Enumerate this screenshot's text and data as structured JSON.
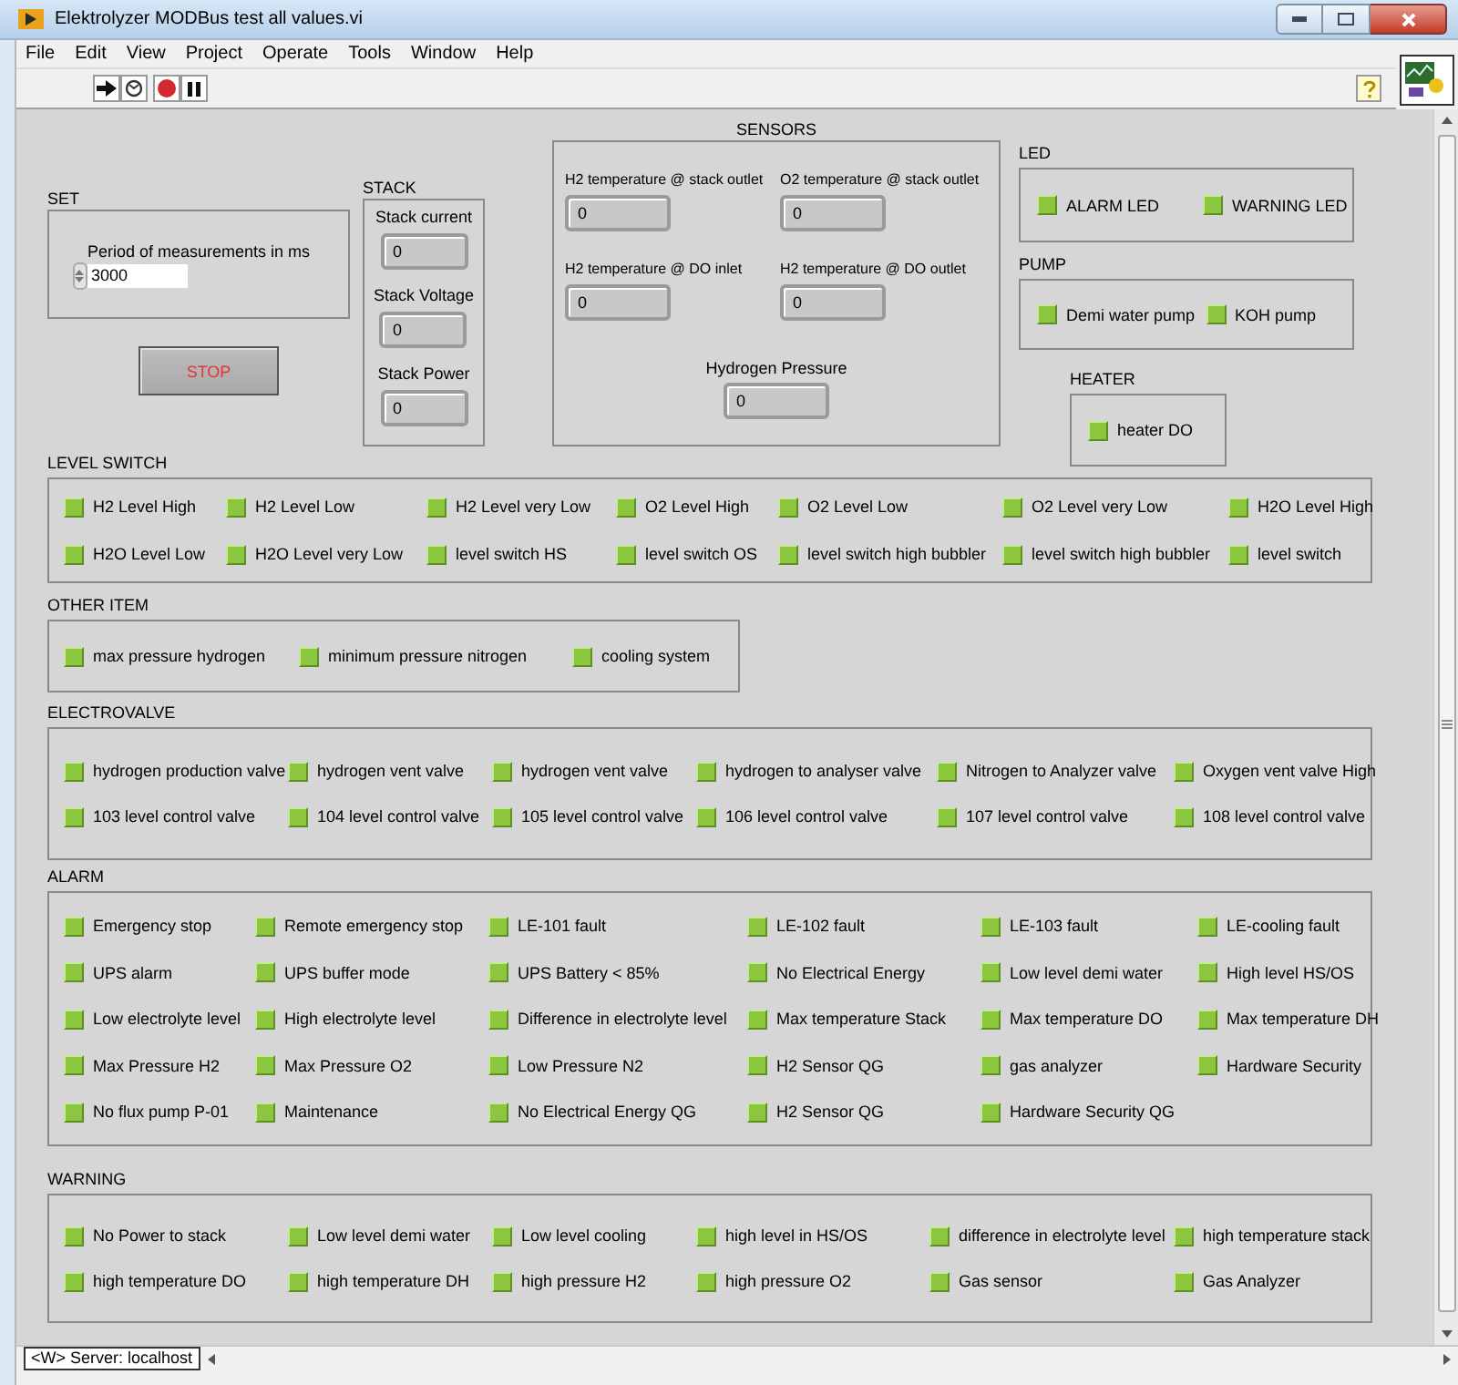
{
  "window": {
    "title": "Elektrolyzer MODBus test all values.vi"
  },
  "menu": [
    "File",
    "Edit",
    "View",
    "Project",
    "Operate",
    "Tools",
    "Window",
    "Help"
  ],
  "set": {
    "label": "SET",
    "control": {
      "label": "Period of measurements in ms",
      "value": "3000"
    }
  },
  "stop_button": "STOP",
  "stack": {
    "label": "STACK",
    "indicators": [
      {
        "label": "Stack current",
        "value": "0"
      },
      {
        "label": "Stack Voltage",
        "value": "0"
      },
      {
        "label": "Stack Power",
        "value": "0"
      }
    ]
  },
  "sensors": {
    "label": "SENSORS",
    "indicators": [
      {
        "label": "H2 temperature @ stack outlet",
        "value": "0"
      },
      {
        "label": "O2 temperature @ stack outlet",
        "value": "0"
      },
      {
        "label": "H2 temperature @ DO inlet",
        "value": "0"
      },
      {
        "label": "H2 temperature @ DO outlet",
        "value": "0"
      },
      {
        "label": "Hydrogen Pressure",
        "value": "0"
      }
    ]
  },
  "side_groups": [
    {
      "label": "LED",
      "leds": [
        {
          "label": "ALARM LED",
          "on": true
        },
        {
          "label": "WARNING LED",
          "on": true
        }
      ]
    },
    {
      "label": "PUMP",
      "leds": [
        {
          "label": "Demi water pump",
          "on": true
        },
        {
          "label": "KOH pump",
          "on": true
        }
      ]
    },
    {
      "label": "HEATER",
      "leds": [
        {
          "label": "heater DO",
          "on": true
        }
      ]
    }
  ],
  "sections": [
    {
      "label": "LEVEL SWITCH",
      "leds": [
        {
          "label": "H2 Level High",
          "on": true
        },
        {
          "label": "H2 Level Low",
          "on": true
        },
        {
          "label": "H2 Level very Low",
          "on": true
        },
        {
          "label": "O2 Level High",
          "on": true
        },
        {
          "label": "O2 Level Low",
          "on": true
        },
        {
          "label": "O2 Level very Low",
          "on": true
        },
        {
          "label": "H2O Level High",
          "on": true
        },
        {
          "label": "H2O Level Low",
          "on": true
        },
        {
          "label": "H2O Level very Low",
          "on": true
        },
        {
          "label": "level switch HS",
          "on": true
        },
        {
          "label": "level switch OS",
          "on": true
        },
        {
          "label": "level switch high bubbler",
          "on": true
        },
        {
          "label": "level switch high bubbler",
          "on": true
        },
        {
          "label": "level switch",
          "on": true
        }
      ]
    },
    {
      "label": "OTHER ITEM",
      "leds": [
        {
          "label": "max pressure hydrogen",
          "on": true
        },
        {
          "label": "minimum pressure nitrogen",
          "on": true
        },
        {
          "label": "cooling system",
          "on": true
        }
      ]
    },
    {
      "label": "ELECTROVALVE",
      "leds": [
        {
          "label": "hydrogen production valve",
          "on": true
        },
        {
          "label": "hydrogen vent valve",
          "on": true
        },
        {
          "label": "hydrogen vent valve",
          "on": true
        },
        {
          "label": "hydrogen to analyser valve",
          "on": true
        },
        {
          "label": "Nitrogen to Analyzer valve",
          "on": true
        },
        {
          "label": "Oxygen vent valve High",
          "on": true
        },
        {
          "label": "103 level control valve",
          "on": true
        },
        {
          "label": "104 level control valve",
          "on": true
        },
        {
          "label": "105 level control valve",
          "on": true
        },
        {
          "label": "106 level control valve",
          "on": true
        },
        {
          "label": "107 level control valve",
          "on": true
        },
        {
          "label": "108 level control valve",
          "on": true
        }
      ]
    },
    {
      "label": "ALARM",
      "leds": [
        {
          "label": "Emergency stop",
          "on": true
        },
        {
          "label": "Remote emergency stop",
          "on": true
        },
        {
          "label": "LE-101 fault",
          "on": true
        },
        {
          "label": "LE-102 fault",
          "on": true
        },
        {
          "label": "LE-103 fault",
          "on": true
        },
        {
          "label": "LE-cooling fault",
          "on": true
        },
        {
          "label": "UPS alarm",
          "on": true
        },
        {
          "label": "UPS buffer mode",
          "on": true
        },
        {
          "label": "UPS Battery < 85%",
          "on": true
        },
        {
          "label": "No Electrical Energy",
          "on": true
        },
        {
          "label": "Low level demi water",
          "on": true
        },
        {
          "label": "High level HS/OS",
          "on": true
        },
        {
          "label": "Low electrolyte level",
          "on": true
        },
        {
          "label": "High electrolyte level",
          "on": true
        },
        {
          "label": "Difference in electrolyte level",
          "on": true
        },
        {
          "label": "Max temperature Stack",
          "on": true
        },
        {
          "label": "Max temperature DO",
          "on": true
        },
        {
          "label": "Max temperature DH",
          "on": true
        },
        {
          "label": "Max Pressure H2",
          "on": true
        },
        {
          "label": "Max Pressure O2",
          "on": true
        },
        {
          "label": "Low Pressure N2",
          "on": true
        },
        {
          "label": "H2 Sensor QG",
          "on": true
        },
        {
          "label": "gas analyzer",
          "on": true
        },
        {
          "label": "Hardware Security",
          "on": true
        },
        {
          "label": "No flux pump P-01",
          "on": true
        },
        {
          "label": "Maintenance",
          "on": true
        },
        {
          "label": "No Electrical Energy QG",
          "on": true
        },
        {
          "label": "H2 Sensor QG",
          "on": true
        },
        {
          "label": "Hardware Security QG",
          "on": true
        }
      ]
    },
    {
      "label": "WARNING",
      "leds": [
        {
          "label": "No Power to stack",
          "on": true
        },
        {
          "label": "Low level demi water",
          "on": true
        },
        {
          "label": "Low level cooling",
          "on": true
        },
        {
          "label": "high level in HS/OS",
          "on": true
        },
        {
          "label": "difference in electrolyte level",
          "on": true
        },
        {
          "label": "high temperature stack",
          "on": true
        },
        {
          "label": "high temperature DO",
          "on": true
        },
        {
          "label": "high temperature DH",
          "on": true
        },
        {
          "label": "high pressure H2",
          "on": true
        },
        {
          "label": "high pressure O2",
          "on": true
        },
        {
          "label": "Gas sensor",
          "on": true
        },
        {
          "label": "Gas Analyzer",
          "on": true
        }
      ]
    }
  ],
  "status_bar": {
    "server": "<W> Server: localhost"
  }
}
